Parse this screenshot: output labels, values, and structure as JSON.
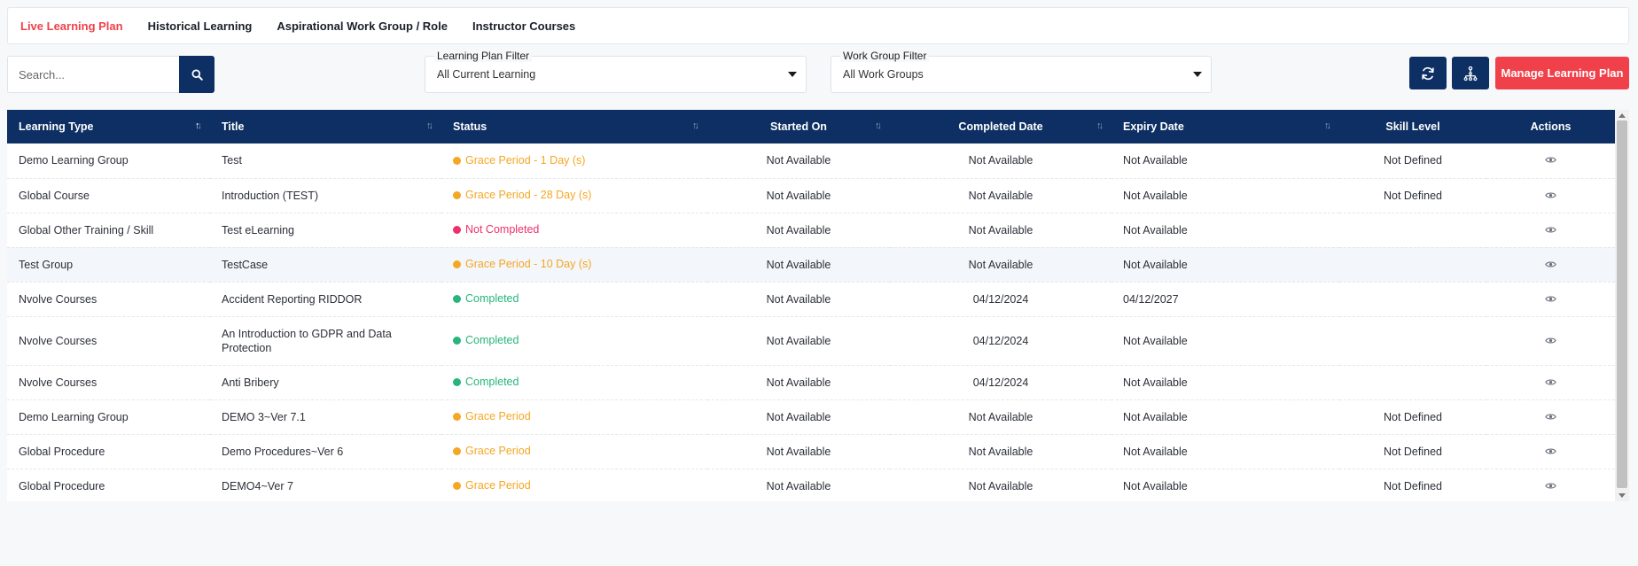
{
  "tabs": [
    {
      "label": "Live Learning Plan",
      "active": true
    },
    {
      "label": "Historical Learning",
      "active": false
    },
    {
      "label": "Aspirational Work Group / Role",
      "active": false
    },
    {
      "label": "Instructor Courses",
      "active": false
    }
  ],
  "search": {
    "placeholder": "Search...",
    "value": ""
  },
  "filters": {
    "learning_plan": {
      "label": "Learning Plan Filter",
      "value": "All Current Learning"
    },
    "work_group": {
      "label": "Work Group Filter",
      "value": "All Work Groups"
    }
  },
  "actions": {
    "manage_label": "Manage Learning Plan"
  },
  "colors": {
    "navy": "#0d2f63",
    "accent_red": "#f0414a",
    "status_grace": "#f5a623",
    "status_not_completed": "#f0306b",
    "status_completed": "#27b57c"
  },
  "table": {
    "columns": [
      {
        "label": "Learning Type",
        "sortable": true
      },
      {
        "label": "Title",
        "sortable": true
      },
      {
        "label": "Status",
        "sortable": true
      },
      {
        "label": "Started On",
        "sortable": true
      },
      {
        "label": "Completed Date",
        "sortable": true
      },
      {
        "label": "Expiry Date",
        "sortable": true
      },
      {
        "label": "Skill Level",
        "sortable": false
      },
      {
        "label": "Actions",
        "sortable": false
      }
    ],
    "rows": [
      {
        "type": "Demo Learning Group",
        "title": "Test",
        "status": "Grace Period - 1 Day (s)",
        "status_kind": "grace",
        "started": "Not Available",
        "completed": "Not Available",
        "expiry": "Not Available",
        "skill": "Not Defined"
      },
      {
        "type": "Global Course",
        "title": "Introduction (TEST)",
        "status": "Grace Period - 28 Day (s)",
        "status_kind": "grace",
        "started": "Not Available",
        "completed": "Not Available",
        "expiry": "Not Available",
        "skill": "Not Defined"
      },
      {
        "type": "Global Other Training / Skill",
        "title": "Test eLearning",
        "status": "Not Completed",
        "status_kind": "not_completed",
        "started": "Not Available",
        "completed": "Not Available",
        "expiry": "Not Available",
        "skill": ""
      },
      {
        "type": "Test Group",
        "title": "TestCase",
        "status": "Grace Period - 10 Day (s)",
        "status_kind": "grace",
        "started": "Not Available",
        "completed": "Not Available",
        "expiry": "Not Available",
        "skill": ""
      },
      {
        "type": "Nvolve Courses",
        "title": "Accident Reporting RIDDOR",
        "status": "Completed",
        "status_kind": "completed",
        "started": "Not Available",
        "completed": "04/12/2024",
        "expiry": "04/12/2027",
        "skill": ""
      },
      {
        "type": "Nvolve Courses",
        "title": "An Introduction to GDPR and Data Protection",
        "status": "Completed",
        "status_kind": "completed",
        "started": "Not Available",
        "completed": "04/12/2024",
        "expiry": "Not Available",
        "skill": ""
      },
      {
        "type": "Nvolve Courses",
        "title": "Anti Bribery",
        "status": "Completed",
        "status_kind": "completed",
        "started": "Not Available",
        "completed": "04/12/2024",
        "expiry": "Not Available",
        "skill": ""
      },
      {
        "type": "Demo Learning Group",
        "title": "DEMO 3~Ver 7.1",
        "status": "Grace Period",
        "status_kind": "grace",
        "started": "Not Available",
        "completed": "Not Available",
        "expiry": "Not Available",
        "skill": "Not Defined"
      },
      {
        "type": "Global Procedure",
        "title": "Demo Procedures~Ver 6",
        "status": "Grace Period",
        "status_kind": "grace",
        "started": "Not Available",
        "completed": "Not Available",
        "expiry": "Not Available",
        "skill": "Not Defined"
      },
      {
        "type": "Global Procedure",
        "title": "DEMO4~Ver 7",
        "status": "Grace Period",
        "status_kind": "grace",
        "started": "Not Available",
        "completed": "Not Available",
        "expiry": "Not Available",
        "skill": "Not Defined"
      }
    ]
  }
}
